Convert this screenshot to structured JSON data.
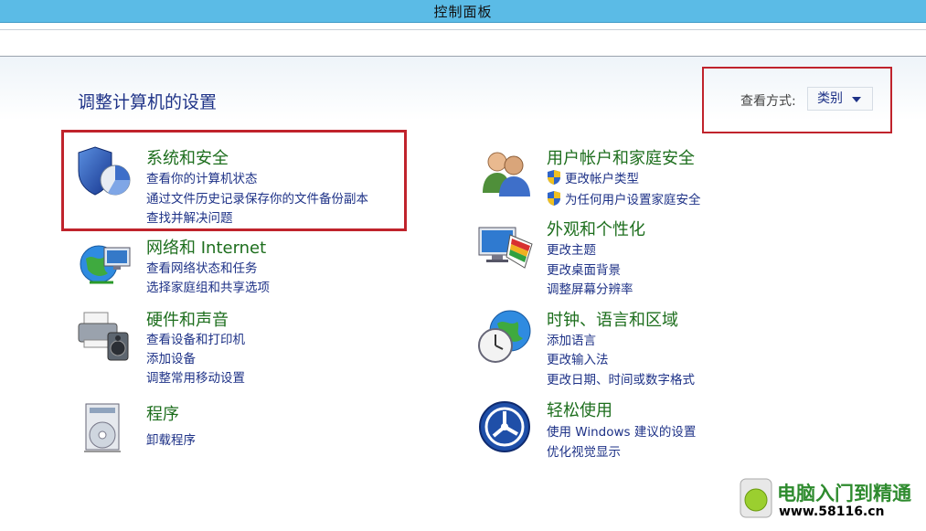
{
  "window": {
    "title": "控制面板"
  },
  "page": {
    "title": "调整计算机的设置"
  },
  "view": {
    "label": "查看方式:",
    "selected": "类别"
  },
  "categories": {
    "system": {
      "title": "系统和安全",
      "links": [
        "查看你的计算机状态",
        "通过文件历史记录保存你的文件备份副本",
        "查找并解决问题"
      ]
    },
    "network": {
      "title": "网络和 Internet",
      "links": [
        "查看网络状态和任务",
        "选择家庭组和共享选项"
      ]
    },
    "hardware": {
      "title": "硬件和声音",
      "links": [
        "查看设备和打印机",
        "添加设备",
        "调整常用移动设置"
      ]
    },
    "programs": {
      "title": "程序",
      "links": [
        "卸载程序"
      ]
    },
    "users": {
      "title": "用户帐户和家庭安全",
      "links": [
        "更改帐户类型",
        "为任何用户设置家庭安全"
      ]
    },
    "appearance": {
      "title": "外观和个性化",
      "links": [
        "更改主题",
        "更改桌面背景",
        "调整屏幕分辨率"
      ]
    },
    "clock": {
      "title": "时钟、语言和区域",
      "links": [
        "添加语言",
        "更改输入法",
        "更改日期、时间或数字格式"
      ]
    },
    "ease": {
      "title": "轻松使用",
      "links": [
        "使用 Windows 建议的设置",
        "优化视觉显示"
      ]
    }
  },
  "watermark": {
    "text": "电脑入门到精通",
    "url": "www.58116.cn"
  },
  "icons": {
    "system": "shield-pie-icon",
    "network": "globe-network-icon",
    "hardware": "printer-speaker-icon",
    "programs": "program-box-icon",
    "users": "users-icon",
    "appearance": "monitor-palette-icon",
    "clock": "globe-clock-icon",
    "ease": "ease-of-access-icon",
    "uac": "uac-shield-icon"
  },
  "colors": {
    "link": "#1e3287",
    "heading": "#1d6e1d",
    "highlight": "#c0232c",
    "titlebar": "#5bbbe6"
  }
}
